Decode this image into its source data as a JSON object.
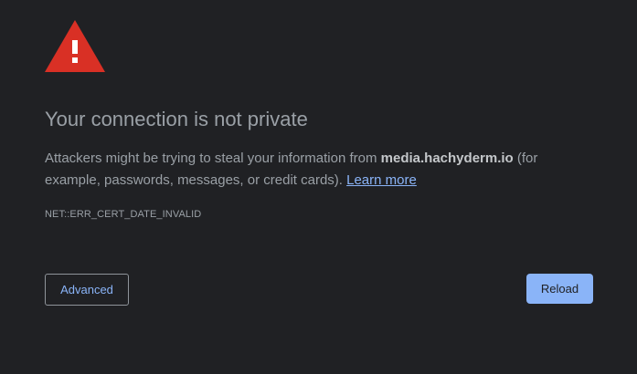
{
  "icon": {
    "name": "warning-triangle-icon",
    "color": "#d93025"
  },
  "heading": "Your connection is not private",
  "explanation": {
    "prefix": "Attackers might be trying to steal your information from ",
    "host": "media.hachyderm.io",
    "suffix": " (for example, passwords, messages, or credit cards). ",
    "learn_more": "Learn more"
  },
  "error_code": "NET::ERR_CERT_DATE_INVALID",
  "buttons": {
    "advanced": "Advanced",
    "reload": "Reload"
  },
  "colors": {
    "background": "#202124",
    "text": "#9aa0a6",
    "accent": "#8ab4f8"
  }
}
